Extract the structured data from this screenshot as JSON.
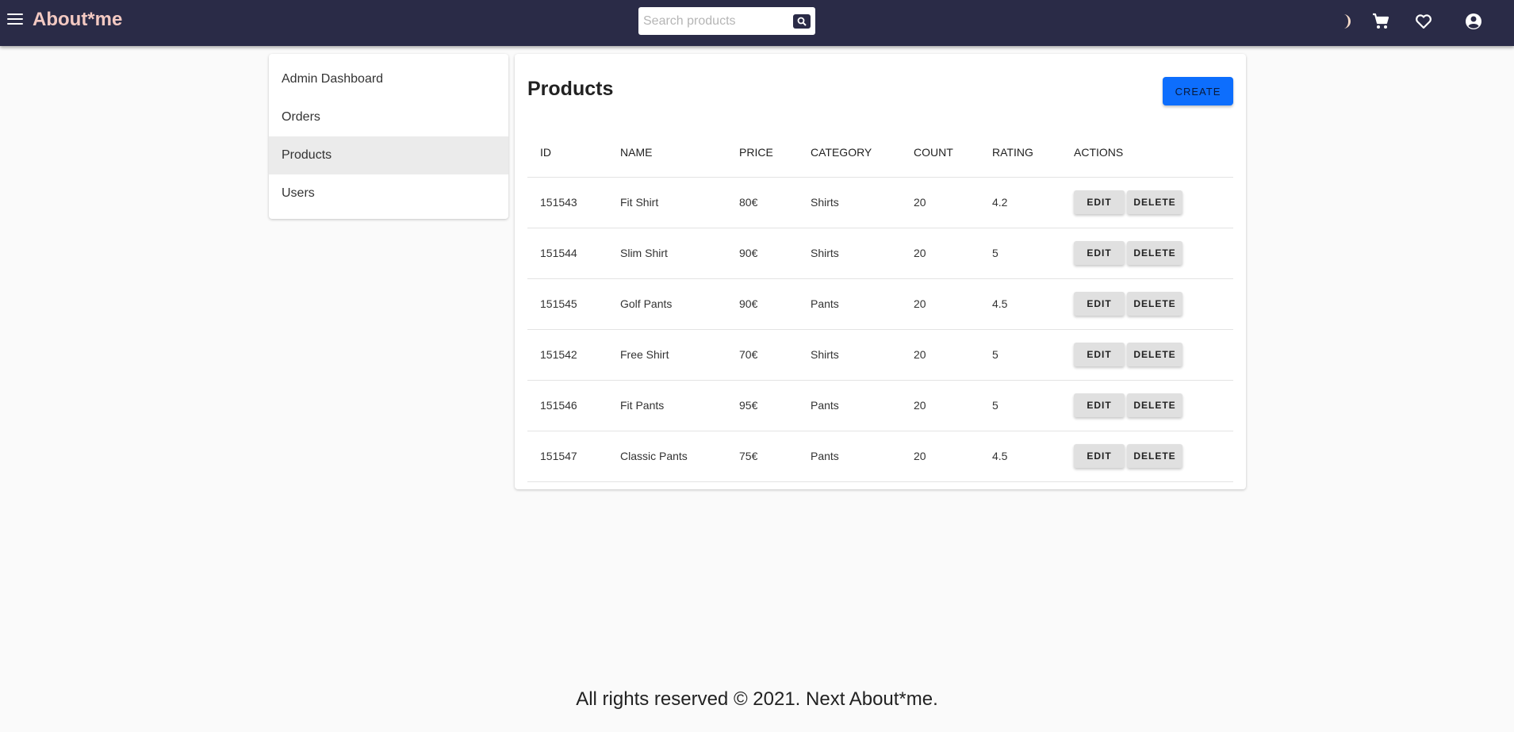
{
  "header": {
    "brand": "About*me",
    "search_placeholder": "Search products",
    "icons": [
      "menu-icon",
      "moon-icon",
      "cart-icon",
      "heart-icon",
      "account-icon"
    ],
    "background": "#2a2b47",
    "brand_color": "#f3c9c2"
  },
  "sidebar": {
    "items": [
      {
        "label": "Admin Dashboard"
      },
      {
        "label": "Orders"
      },
      {
        "label": "Products",
        "active": true
      },
      {
        "label": "Users"
      }
    ]
  },
  "main": {
    "title": "Products",
    "create_label": "CREATE",
    "accent": "#0d6efd",
    "columns": [
      "ID",
      "NAME",
      "PRICE",
      "CATEGORY",
      "COUNT",
      "RATING",
      "ACTIONS"
    ],
    "rows": [
      {
        "id": "151543",
        "name": "Fit Shirt",
        "price": "80€",
        "category": "Shirts",
        "count": "20",
        "rating": "4.2"
      },
      {
        "id": "151544",
        "name": "Slim Shirt",
        "price": "90€",
        "category": "Shirts",
        "count": "20",
        "rating": "5"
      },
      {
        "id": "151545",
        "name": "Golf Pants",
        "price": "90€",
        "category": "Pants",
        "count": "20",
        "rating": "4.5"
      },
      {
        "id": "151542",
        "name": "Free Shirt",
        "price": "70€",
        "category": "Shirts",
        "count": "20",
        "rating": "5"
      },
      {
        "id": "151546",
        "name": "Fit Pants",
        "price": "95€",
        "category": "Pants",
        "count": "20",
        "rating": "5"
      },
      {
        "id": "151547",
        "name": "Classic Pants",
        "price": "75€",
        "category": "Pants",
        "count": "20",
        "rating": "4.5"
      }
    ],
    "edit_label": "EDIT",
    "delete_label": "DELETE"
  },
  "footer": {
    "text": "All rights reserved © 2021. Next About*me."
  }
}
